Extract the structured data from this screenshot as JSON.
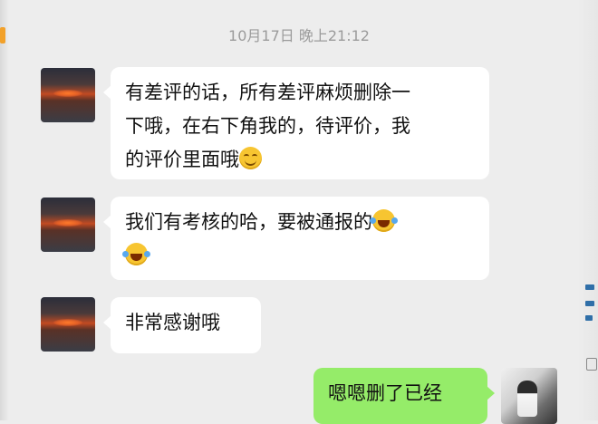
{
  "chat": {
    "timestamp": "10月17日  晚上21:12",
    "messages": [
      {
        "sender": "other",
        "lines": [
          "有差评的话，所有差评麻烦删除一",
          "下哦，在右下角我的，待评价，我",
          "的评价里面哦"
        ],
        "trailing_emoji": "smiling-face-icon"
      },
      {
        "sender": "other",
        "lines": [
          "我们有考核的哈，要被通报的"
        ],
        "trailing_emoji": "tears-of-joy-icon"
      },
      {
        "sender": "other",
        "lines": [
          "非常感谢哦"
        ]
      },
      {
        "sender": "me",
        "lines": [
          "嗯嗯删了已经"
        ]
      }
    ]
  },
  "colors": {
    "background": "#ededed",
    "incoming_bubble": "#ffffff",
    "outgoing_bubble": "#95ec69",
    "timestamp_text": "#9b9b9b"
  }
}
